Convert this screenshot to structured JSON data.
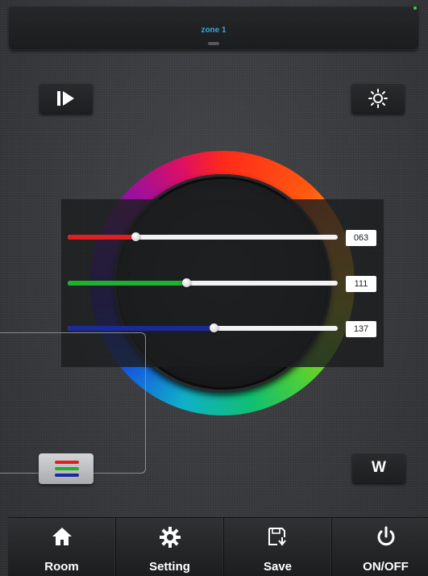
{
  "header": {
    "zone_title": "zone 1"
  },
  "controls": {
    "play_icon": "play-step-icon",
    "brightness_icon": "sun-icon",
    "white_button_label": "W",
    "rgb_button_icon": "rgb-bars-icon"
  },
  "sliders": [
    {
      "name": "red",
      "value": "063",
      "level": 0.25,
      "color": "#e02020"
    },
    {
      "name": "green",
      "value": "111",
      "level": 0.44,
      "color": "#20b030"
    },
    {
      "name": "blue",
      "value": "137",
      "level": 0.54,
      "color": "#1a2a9a"
    }
  ],
  "nav": {
    "items": [
      {
        "label": "Room",
        "icon": "home-icon"
      },
      {
        "label": "Setting",
        "icon": "gear-icon"
      },
      {
        "label": "Save",
        "icon": "save-icon"
      },
      {
        "label": "ON/OFF",
        "icon": "power-icon"
      }
    ]
  }
}
